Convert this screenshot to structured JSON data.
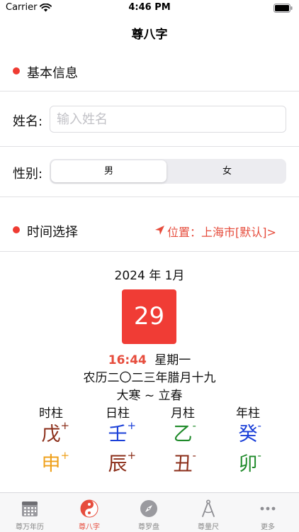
{
  "status": {
    "carrier": "Carrier",
    "time": "4:46 PM"
  },
  "nav": {
    "title": "尊八字"
  },
  "basic_info": {
    "header": "基本信息",
    "name_label": "姓名:",
    "name_placeholder": "输入姓名",
    "name_value": "",
    "gender_label": "性别:",
    "gender_options": [
      "男",
      "女"
    ],
    "gender_selected": "男"
  },
  "time_select": {
    "header": "时间选择",
    "location": "位置：上海市[默认]>"
  },
  "calendar": {
    "month": "2024 年 1月",
    "day": "29",
    "time": "16:44",
    "weekday": "星期一",
    "lunar": "农历二〇二三年腊月十九",
    "solar_terms": "大寒 ~ 立春"
  },
  "pillars": [
    {
      "name": "时柱",
      "stem": "戊",
      "stem_sign": "+",
      "branch": "申",
      "branch_sign": "+"
    },
    {
      "name": "日柱",
      "stem": "壬",
      "stem_sign": "+",
      "branch": "辰",
      "branch_sign": "+"
    },
    {
      "name": "月柱",
      "stem": "乙",
      "stem_sign": "-",
      "branch": "丑",
      "branch_sign": "-"
    },
    {
      "name": "年柱",
      "stem": "癸",
      "stem_sign": "-",
      "branch": "卯",
      "branch_sign": "-"
    }
  ],
  "element_colors": {
    "earth": "#8b2d18",
    "water": "#1a3fd8",
    "wood": "#1f8a2a",
    "metal": "#efa11c",
    "text_red": "#e64c3c",
    "accent": "#f03c35"
  },
  "tabs": [
    {
      "label": "尊万年历",
      "icon": "calendar-icon",
      "active": false
    },
    {
      "label": "尊八字",
      "icon": "yin-yang-icon",
      "active": true
    },
    {
      "label": "尊罗盘",
      "icon": "compass-icon",
      "active": false
    },
    {
      "label": "尊量尺",
      "icon": "divider-tool-icon",
      "active": false
    },
    {
      "label": "更多",
      "icon": "more-icon",
      "active": false
    }
  ]
}
